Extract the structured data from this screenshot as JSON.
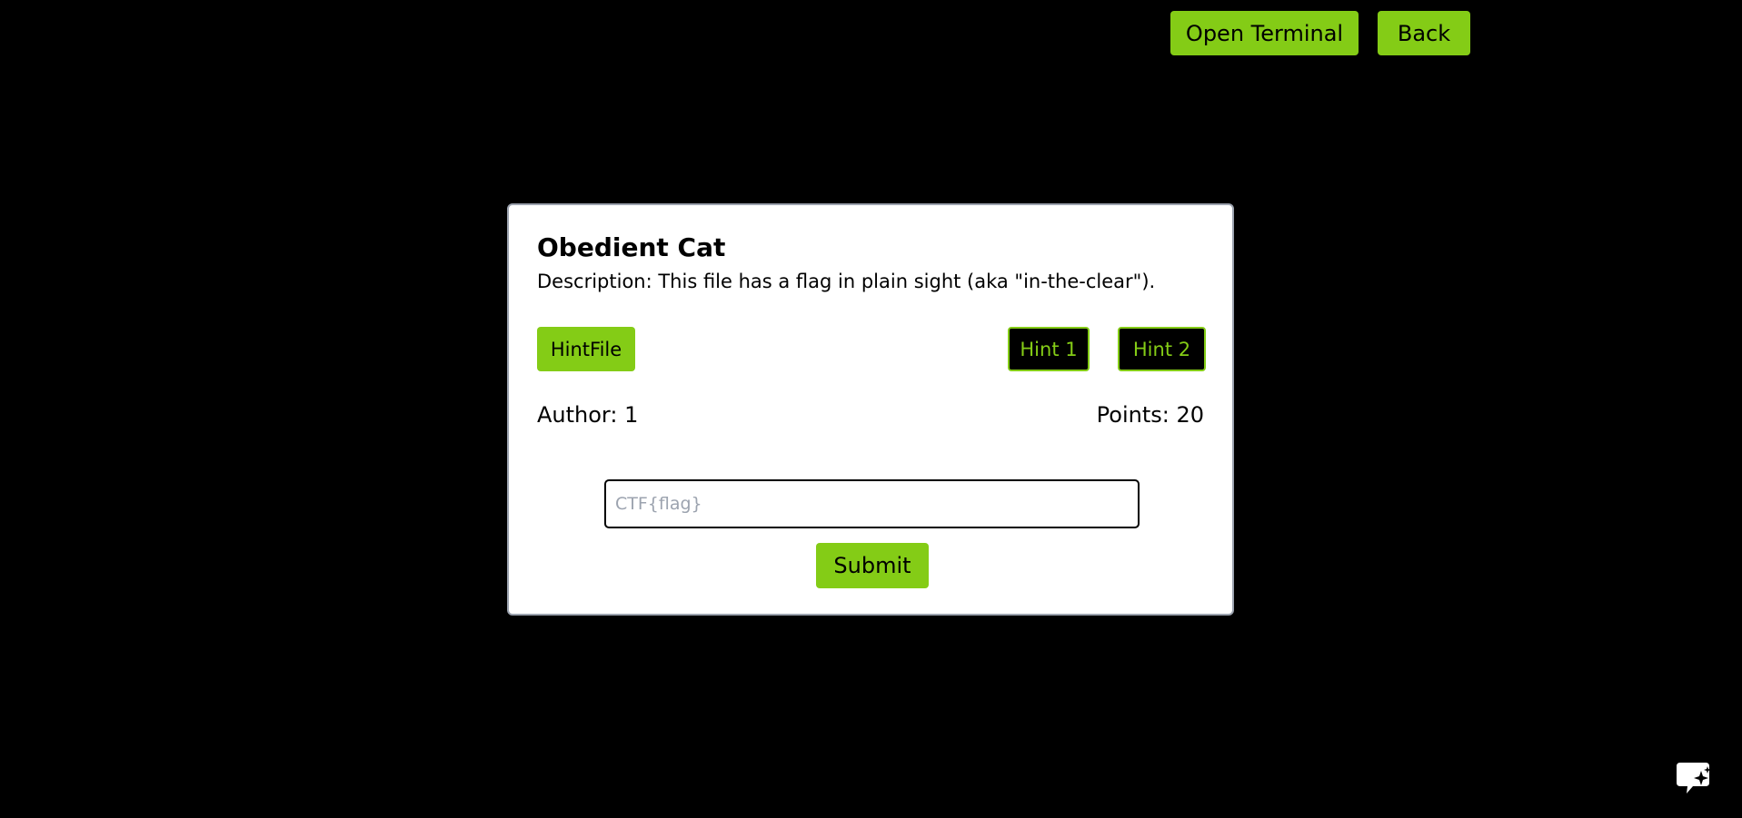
{
  "header": {
    "open_terminal_label": "Open Terminal",
    "back_label": "Back"
  },
  "challenge": {
    "title": "Obedient Cat",
    "description": "Description: This file has a flag in plain sight (aka \"in-the-clear\").",
    "hintfile_label": "HintFile",
    "hint1_label": "Hint 1",
    "hint2_label": "Hint 2",
    "author": "Author: 1",
    "points": "Points: 20",
    "flag_placeholder": "CTF{flag}",
    "flag_value": "",
    "submit_label": "Submit"
  },
  "icons": {
    "chat_widget": "chat-sparkle-icon"
  },
  "colors": {
    "accent": "#84cc16",
    "background": "#000000",
    "card": "#ffffff"
  }
}
